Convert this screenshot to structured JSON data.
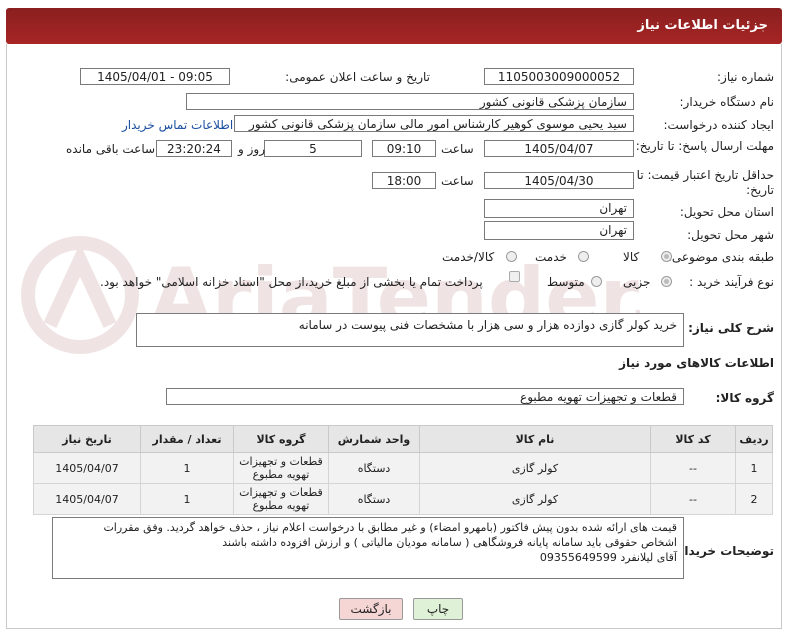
{
  "header": {
    "title": "جزئیات اطلاعات نیاز"
  },
  "form": {
    "need_number_label": "شماره نیاز:",
    "need_number": "1105003009000052",
    "announce_label": "تاریخ و ساعت اعلان عمومی:",
    "announce_value": "1405/04/01 - 09:05",
    "buyer_org_label": "نام دستگاه خریدار:",
    "buyer_org": "سازمان پزشکی قانونی کشور",
    "creator_label": "ایجاد کننده درخواست:",
    "creator": "سید یحیی موسوی کوهیر کارشناس امور مالی سازمان پزشکی قانونی کشور",
    "contact_link": "اطلاعات تماس خریدار",
    "deadline_label": "مهلت ارسال پاسخ: تا تاریخ:",
    "deadline_date": "1405/04/07",
    "time_word": "ساعت",
    "deadline_time": "09:10",
    "days_count": "5",
    "days_word": "روز و",
    "remaining_time": "23:20:24",
    "remaining_word": "ساعت باقی مانده",
    "price_validity_label": "حداقل تاریخ اعتبار قیمت: تا تاریخ:",
    "price_date": "1405/04/30",
    "price_time": "18:00",
    "province_label": "استان محل تحویل:",
    "province": "تهران",
    "city_label": "شهر محل تحویل:",
    "city": "تهران",
    "category_label": "طبقه بندی موضوعی:",
    "category_options": [
      "کالا",
      "خدمت",
      "کالا/خدمت"
    ],
    "process_label": "نوع فرآیند خرید :",
    "process_options": [
      "جزیی",
      "متوسط"
    ],
    "payment_note": "پرداخت تمام یا بخشی از مبلغ خرید،از محل \"اسناد خزانه اسلامی\" خواهد بود.",
    "description_label": "شرح کلی نیاز:",
    "description": "خرید کولر گازی دوازده هزار و سی هزار با مشخصات فنی پیوست در سامانه",
    "goods_info_title": "اطلاعات کالاهای مورد نیاز",
    "goods_group_label": "گروه کالا:",
    "goods_group": "قطعات و تجهیزات تهویه مطبوع",
    "buyer_notes_label": "توضیحات خریدار:",
    "buyer_notes_lines": [
      "قیمت های ارائه شده بدون پیش فاکتور (بامهرو امضاء) و غیر مطابق با درخواست اعلام نیاز ، حذف خواهد گردید. وفق مقررات",
      "اشخاص حقوقی باید سامانه پایانه فروشگاهی ( سامانه مودیان مالیاتی ) و ارزش افزوده  داشته باشند",
      "آقای لیلانفرد        09355649599"
    ]
  },
  "table": {
    "headers": [
      "ردیف",
      "کد کالا",
      "نام کالا",
      "واحد شمارش",
      "گروه کالا",
      "تعداد / مقدار",
      "تاریخ نیاز"
    ],
    "rows": [
      [
        "1",
        "--",
        "کولر گازی",
        "دستگاه",
        "قطعات و تجهیزات تهویه مطبوع",
        "1",
        "1405/04/07"
      ],
      [
        "2",
        "--",
        "کولر گازی",
        "دستگاه",
        "قطعات و تجهیزات تهویه مطبوع",
        "1",
        "1405/04/07"
      ]
    ]
  },
  "buttons": {
    "print": "چاپ",
    "back": "بازگشت"
  },
  "watermark": "AriaTender.net",
  "colors": {
    "header": "#9c2323",
    "link": "#1a4fa0",
    "print_btn": "#dff2d8",
    "back_btn": "#f6d5d5"
  }
}
